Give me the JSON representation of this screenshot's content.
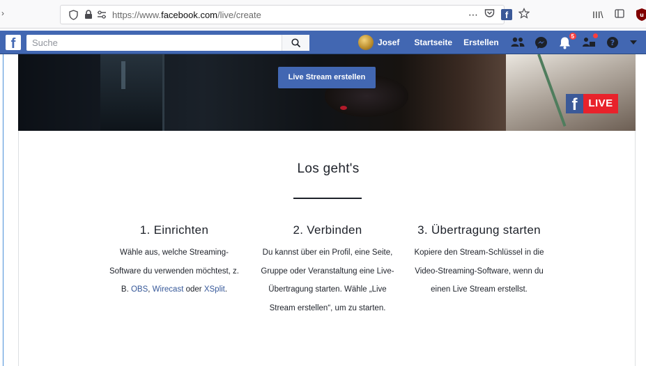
{
  "browser": {
    "url_prefix": "https://www.",
    "url_host": "facebook.com",
    "url_path": "/live/create",
    "more_label": "⋯",
    "pocket_icon": "pocket-icon",
    "fb_ext_label": "f",
    "star_icon": "bookmark-star-icon",
    "library_label": "III\\",
    "sidebar_icon": "sidebar-icon"
  },
  "fb_header": {
    "logo_label": "f",
    "search_placeholder": "Suche",
    "user_name": "Josef",
    "nav_home": "Startseite",
    "nav_create": "Erstellen",
    "notifications_count": "5",
    "brand_color": "#4267b2"
  },
  "hero": {
    "button_label": "Live Stream erstellen",
    "badge_f": "f",
    "badge_live": "LIVE"
  },
  "main": {
    "title": "Los geht's",
    "steps": [
      {
        "heading": "1. Einrichten",
        "text_before": "Wähle aus, welche Streaming-Software du verwenden möchtest, z. B. ",
        "link1": "OBS",
        "sep1": ", ",
        "link2": "Wirecast",
        "sep2": " oder ",
        "link3": "XSplit",
        "text_after": "."
      },
      {
        "heading": "2. Verbinden",
        "text": "Du kannst über ein Profil, eine Seite, Gruppe oder Veranstaltung eine Live-Übertragung starten. Wähle „Live Stream erstellen“, um zu starten."
      },
      {
        "heading": "3. Übertragung starten",
        "text": "Kopiere den Stream-Schlüssel in die Video-Streaming-Software, wenn du einen Live Stream erstellst."
      }
    ]
  }
}
